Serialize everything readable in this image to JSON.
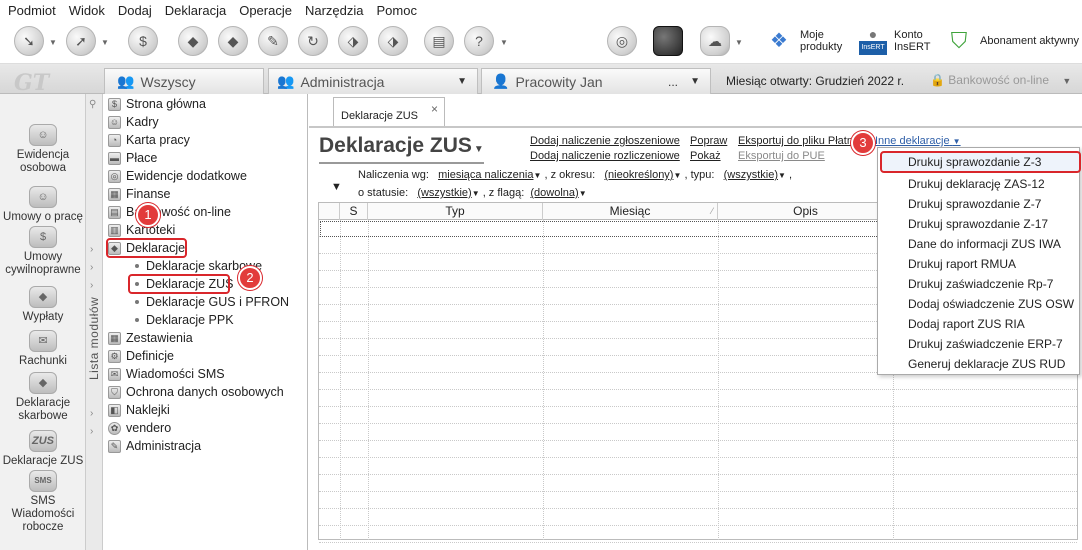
{
  "menu": [
    "Podmiot",
    "Widok",
    "Dodaj",
    "Deklaracja",
    "Operacje",
    "Narzędzia",
    "Pomoc"
  ],
  "toolbar": {
    "moje_produkty": [
      "Moje",
      "produkty"
    ],
    "konto": [
      "Konto",
      "InsERT"
    ],
    "abonament": "Abonament aktywny",
    "insert_logo": "InsERT"
  },
  "top_tabs": {
    "logo": "GT",
    "wszyscy": "Wszyscy",
    "administracja": "Administracja",
    "pracownik": "Pracowity Jan",
    "pracownik_more": "...",
    "month_label": "Miesiąc otwarty: Grudzień 2022 r.",
    "bank": "Bankowość on-line"
  },
  "left_modules": [
    {
      "label": "Ewidencja osobowa"
    },
    {
      "label": "Umowy o pracę"
    },
    {
      "label": "Umowy cywilnoprawne"
    },
    {
      "label": "Wypłaty"
    },
    {
      "label": "Rachunki"
    },
    {
      "label": "Deklaracje skarbowe"
    },
    {
      "label": "Deklaracje ZUS",
      "glyph": "ZUS"
    },
    {
      "label": "SMS Wiadomości robocze",
      "glyph": "SMS"
    }
  ],
  "module_list_label": "Lista modułów",
  "tree": [
    "Strona główna",
    "Kadry",
    "Karta pracy",
    "Płace",
    "Ewidencje dodatkowe",
    "Finanse",
    "Bankowość on-line",
    "Kartoteki",
    "Deklaracje",
    "Deklaracje skarbowe",
    "Deklaracje ZUS",
    "Deklaracje GUS i PFRON",
    "Deklaracje PPK",
    "Zestawienia",
    "Definicje",
    "Wiadomości SMS",
    "Ochrona danych osobowych",
    "Naklejki",
    "vendero",
    "Administracja"
  ],
  "badges": [
    "1",
    "2",
    "3"
  ],
  "content": {
    "doc_tab": "Deklaracje ZUS",
    "doc_tab_close": "×",
    "title": "Deklaracje ZUS",
    "actions": {
      "dodaj_zgl": "Dodaj naliczenie zgłoszeniowe",
      "dodaj_rozl": "Dodaj naliczenie rozliczeniowe",
      "popraw": "Popraw",
      "pokaz": "Pokaż",
      "eksport_platnik": "Eksportuj do pliku Płatnika",
      "eksport_pue": "Eksportuj do PUE",
      "inne": "Inne deklaracje"
    },
    "filters": {
      "naliczenia_label": "Naliczenia wg:",
      "naliczenia_value": "miesiąca naliczenia",
      "okres_label": ", z okresu:",
      "okres_value": "(nieokreślony)",
      "typ_label": ", typu:",
      "typ_value": "(wszystkie)",
      "statusie_label": "o statusie:",
      "statusie_value": "(wszystkie)",
      "flaga_label": ", z flagą:",
      "flaga_value": "(dowolna)"
    },
    "columns": [
      "S",
      "Typ",
      "Miesiąc",
      "Opis"
    ]
  },
  "dropdown": [
    "Drukuj sprawozdanie Z-3",
    "Drukuj deklarację ZAS-12",
    "Drukuj sprawozdanie Z-7",
    "Drukuj sprawozdanie Z-17",
    "Dane do informacji ZUS IWA",
    "Drukuj raport RMUA",
    "Drukuj zaświadczenie Rp-7",
    "Dodaj oświadczenie ZUS OSW",
    "Dodaj raport ZUS RIA",
    "Drukuj zaświadczenie ERP-7",
    "Generuj deklaracje ZUS RUD"
  ]
}
